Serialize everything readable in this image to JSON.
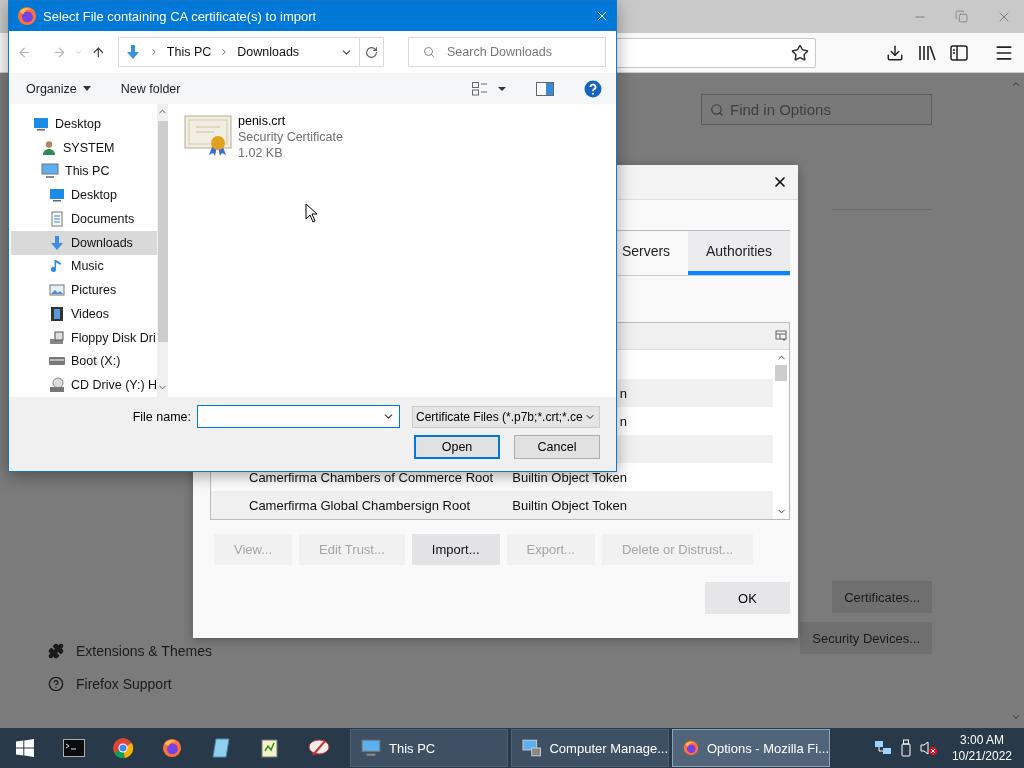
{
  "browser": {
    "search": {
      "placeholder": "Find in Options"
    },
    "sidebar": [
      {
        "label": "Extensions & Themes",
        "kind": "extensions"
      },
      {
        "label": "Firefox Support",
        "kind": "support"
      }
    ],
    "buttons": [
      "Certificates...",
      "Security Devices..."
    ]
  },
  "certificate_manager": {
    "tabs": [
      {
        "label": "Servers",
        "selected": false
      },
      {
        "label": "Authorities",
        "selected": true
      }
    ],
    "rows": [
      {
        "token": "n"
      },
      {
        "token": "n"
      },
      {},
      {
        "name": "Camerfirma Chambers of Commerce Root",
        "token": "Builtin Object Token"
      },
      {
        "name": "Camerfirma Global Chambersign Root",
        "token": "Builtin Object Token"
      }
    ],
    "actions": [
      {
        "label": "View...",
        "disabled": true
      },
      {
        "label": "Edit Trust...",
        "disabled": true
      },
      {
        "label": "Import...",
        "disabled": false
      },
      {
        "label": "Export...",
        "disabled": true
      },
      {
        "label": "Delete or Distrust...",
        "disabled": true
      }
    ],
    "ok": "OK"
  },
  "file_dialog": {
    "title": "Select File containing CA certificate(s) to import",
    "path": [
      "This PC",
      "Downloads"
    ],
    "search": {
      "placeholder": "Search Downloads"
    },
    "toolbar": [
      "Organize",
      "New folder"
    ],
    "tree": [
      {
        "label": "Desktop",
        "kind": "desktop",
        "selected": false,
        "children": [
          {
            "label": "SYSTEM",
            "kind": "user",
            "selected": false
          },
          {
            "label": "This PC",
            "kind": "pc",
            "selected": false,
            "children": [
              {
                "label": "Desktop",
                "kind": "desktop",
                "selected": false
              },
              {
                "label": "Documents",
                "kind": "documents",
                "selected": false
              },
              {
                "label": "Downloads",
                "kind": "downloads",
                "selected": true
              },
              {
                "label": "Music",
                "kind": "music",
                "selected": false
              },
              {
                "label": "Pictures",
                "kind": "pictures",
                "selected": false
              },
              {
                "label": "Videos",
                "kind": "videos",
                "selected": false
              },
              {
                "label": "Floppy Disk Dri",
                "kind": "floppy",
                "selected": false
              },
              {
                "label": "Boot (X:)",
                "kind": "drive",
                "selected": false
              },
              {
                "label": "CD Drive (Y:) H",
                "kind": "cd",
                "selected": false
              }
            ]
          }
        ]
      }
    ],
    "files": [
      {
        "name": "penis.crt",
        "type": "Security Certificate",
        "size": "1.02 KB"
      }
    ],
    "file_name_label": "File name:",
    "file_type": "Certificate Files (*.p7b;*.crt;*.ce",
    "buttons": [
      {
        "label": "Open",
        "default": true
      },
      {
        "label": "Cancel",
        "default": false
      }
    ]
  },
  "taskbar": {
    "pinned": [
      {
        "kind": "terminal"
      },
      {
        "kind": "chrome"
      },
      {
        "kind": "firefox"
      },
      {
        "kind": "notebook"
      },
      {
        "kind": "notepad"
      },
      {
        "kind": "paint"
      }
    ],
    "tasks": [
      {
        "label": "This PC",
        "kind": "pc",
        "selected": false
      },
      {
        "label": "Computer Manage...",
        "kind": "management",
        "selected": false
      },
      {
        "label": "Options - Mozilla Fi...",
        "kind": "firefox",
        "selected": true
      }
    ],
    "time": "3:00 AM",
    "date": "10/21/2022"
  }
}
